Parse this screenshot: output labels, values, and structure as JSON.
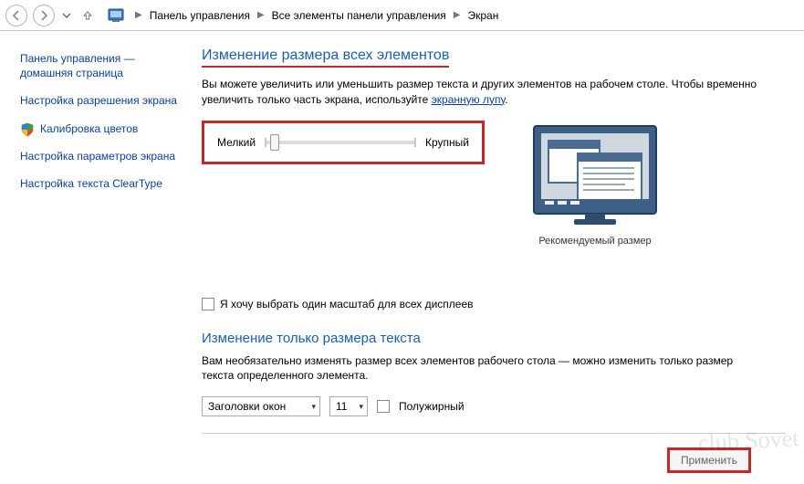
{
  "breadcrumb": {
    "items": [
      "Панель управления",
      "Все элементы панели управления",
      "Экран"
    ]
  },
  "sidebar": {
    "home_line1": "Панель управления —",
    "home_line2": "домашняя страница",
    "items": [
      "Настройка разрешения экрана",
      "Калибровка цветов",
      "Настройка параметров экрана",
      "Настройка текста ClearType"
    ]
  },
  "main": {
    "heading1": "Изменение размера всех элементов",
    "para1_prefix": "Вы можете увеличить или уменьшить размер текста и других элементов на рабочем столе. Чтобы временно увеличить только часть экрана, используйте ",
    "para1_link": "экранную лупу",
    "para1_suffix": ".",
    "slider_small_label": "Мелкий",
    "slider_large_label": "Крупный",
    "preview_caption": "Рекомендуемый размер",
    "chk_same_scale": "Я хочу выбрать один масштаб для всех дисплеев",
    "heading2": "Изменение только размера текста",
    "para2": "Вам необязательно изменять размер всех элементов рабочего стола — можно изменить только размер текста определенного элемента.",
    "select_item": "Заголовки окон",
    "select_size": "11",
    "chk_bold": "Полужирный",
    "apply_label": "Применить"
  },
  "watermark": "club Sovet"
}
